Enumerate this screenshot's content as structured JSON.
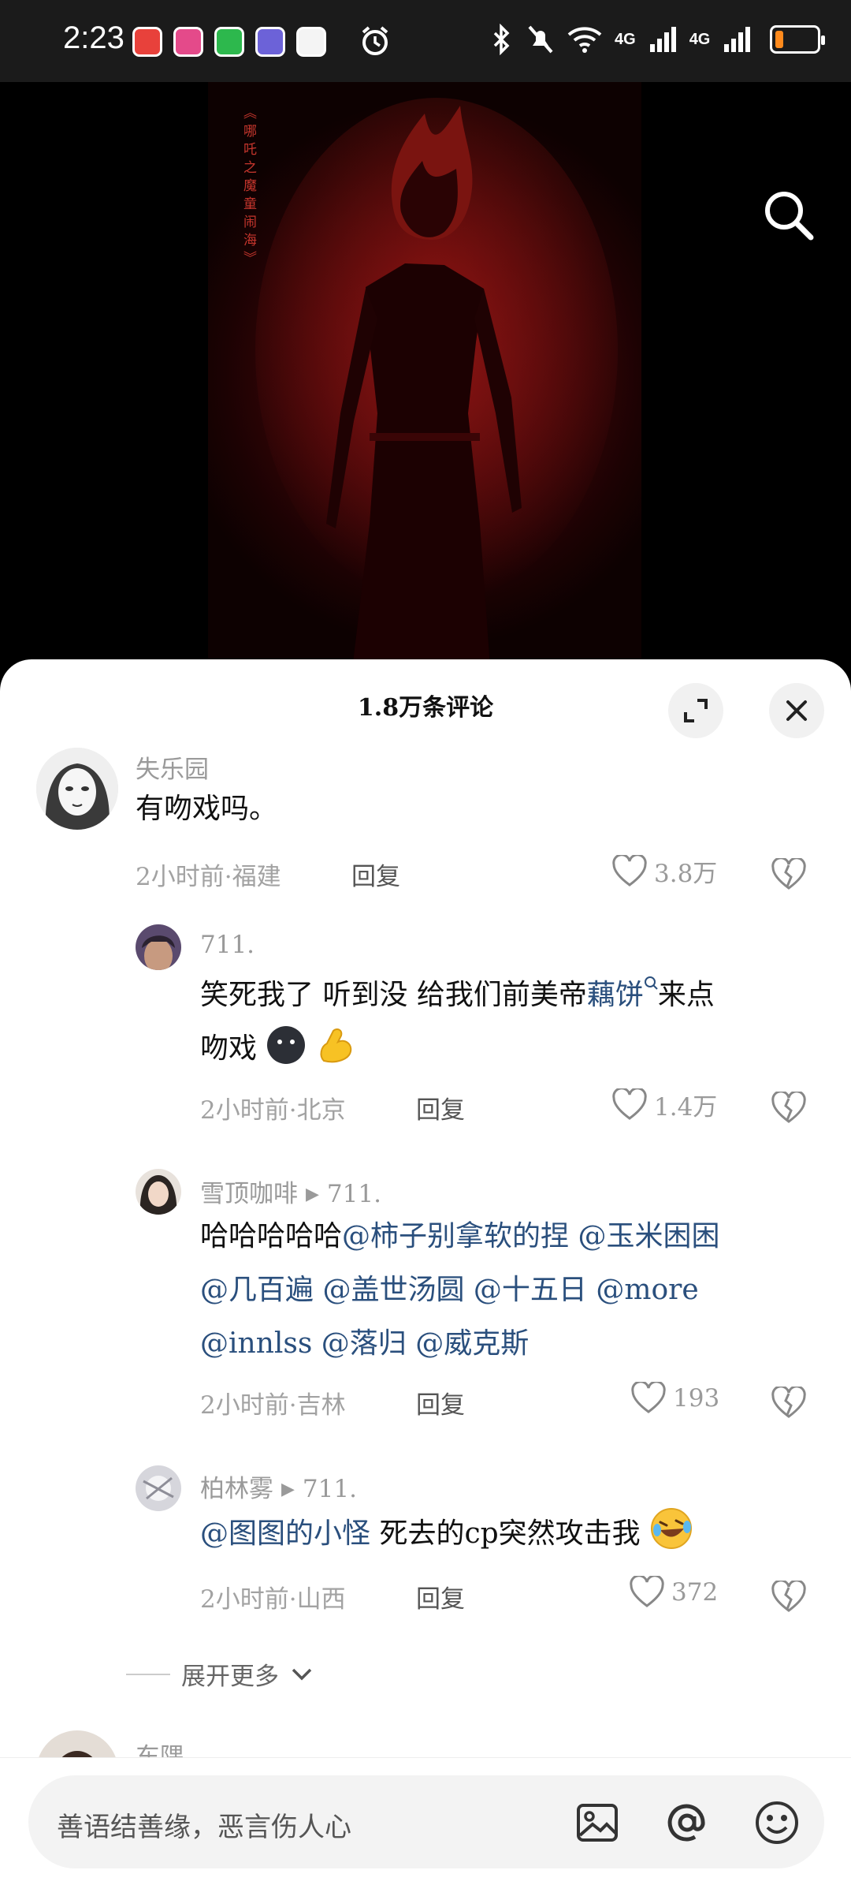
{
  "status_bar": {
    "time": "2:23",
    "network_1": "4G",
    "network_2": "4G",
    "battery_level": 0.2,
    "battery_color": "#ff8a1c"
  },
  "poster": {
    "vertical_text": "《哪吒之魔童闹海》"
  },
  "comments_sheet": {
    "title": "1.8万条评论",
    "expand_icon": "expand-icon",
    "close_icon": "close-icon"
  },
  "comments": [
    {
      "user": "失乐园",
      "text": "有吻戏吗。",
      "time": "2小时前·福建",
      "reply": "回复",
      "likes": "3.8万"
    }
  ],
  "replies": [
    {
      "user": "711.",
      "line1_pre": "笑死我了 听到没 给我们前美帝",
      "line1_link": "藕饼",
      "line1_post": "来点",
      "line2": "吻戏",
      "time": "2小时前·北京",
      "reply": "回复",
      "likes": "1.4万"
    },
    {
      "user": "雪顶咖啡",
      "reply_to": "711.",
      "line1_pre": "哈哈哈哈哈",
      "line1_link": "@柿子别拿软的捏 @玉米困困",
      "line2": "@几百遍 @盖世汤圆 @十五日 @more",
      "line3": "@innlss @落归 @威克斯",
      "time": "2小时前·吉林",
      "reply": "回复",
      "likes": "193"
    },
    {
      "user": "柏林雾",
      "reply_to": "711.",
      "line1_link": "@图图的小怪",
      "line1_post": " 死去的cp突然攻击我",
      "time": "2小时前·山西",
      "reply": "回复",
      "likes": "372"
    }
  ],
  "expand_more": "展开更多",
  "next_comment_user": "东隅",
  "input": {
    "placeholder": "善语结善缘，恶言伤人心"
  },
  "colors": {
    "mention": "#2a4f7d",
    "meta": "#a2a2a2"
  }
}
